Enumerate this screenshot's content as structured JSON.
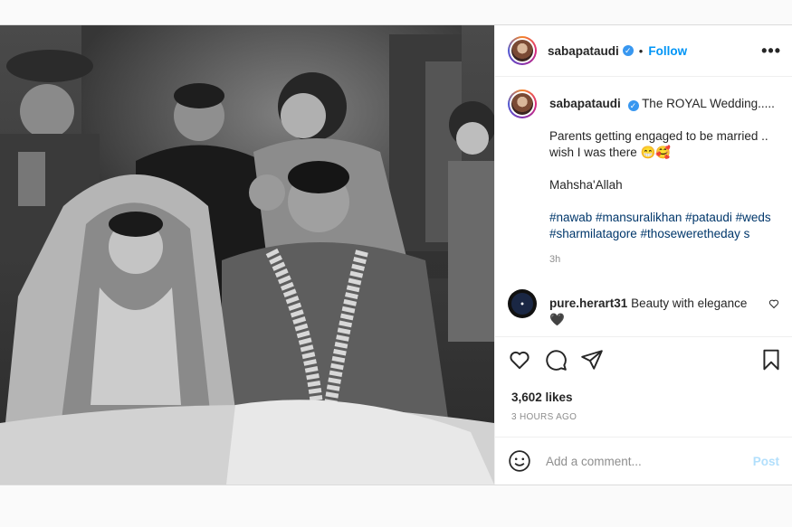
{
  "header": {
    "username": "sabapataudi",
    "separator": "•",
    "follow_label": "Follow",
    "more_label": "•••"
  },
  "caption": {
    "username": "sabapataudi",
    "title": "The ROYAL Wedding.....",
    "line1": "Parents getting engaged to be married ..",
    "line2": "wish I was there 😁🥰",
    "line3": "Mahsha'Allah",
    "hashtags_line1": "#nawab #mansuralikhan #pataudi #weds",
    "hashtags_line2": "#sharmilatagore #thoseweretheday s",
    "time": "3h"
  },
  "comment": {
    "username": "pure.herart31",
    "text": "Beauty with elegance",
    "text_line2": "🖤",
    "like_icon": "heart-outline-icon"
  },
  "actions": {
    "icons": [
      "heart-icon",
      "comment-icon",
      "share-icon",
      "bookmark-icon"
    ]
  },
  "likes": "3,602 likes",
  "posted_ago": "3 HOURS AGO",
  "add_comment": {
    "placeholder": "Add a comment...",
    "post_label": "Post"
  },
  "colors": {
    "link_blue": "#0095f6",
    "hashtag_blue": "#00376b",
    "post_disabled": "#b2dffc",
    "verified_blue": "#3897f0"
  }
}
